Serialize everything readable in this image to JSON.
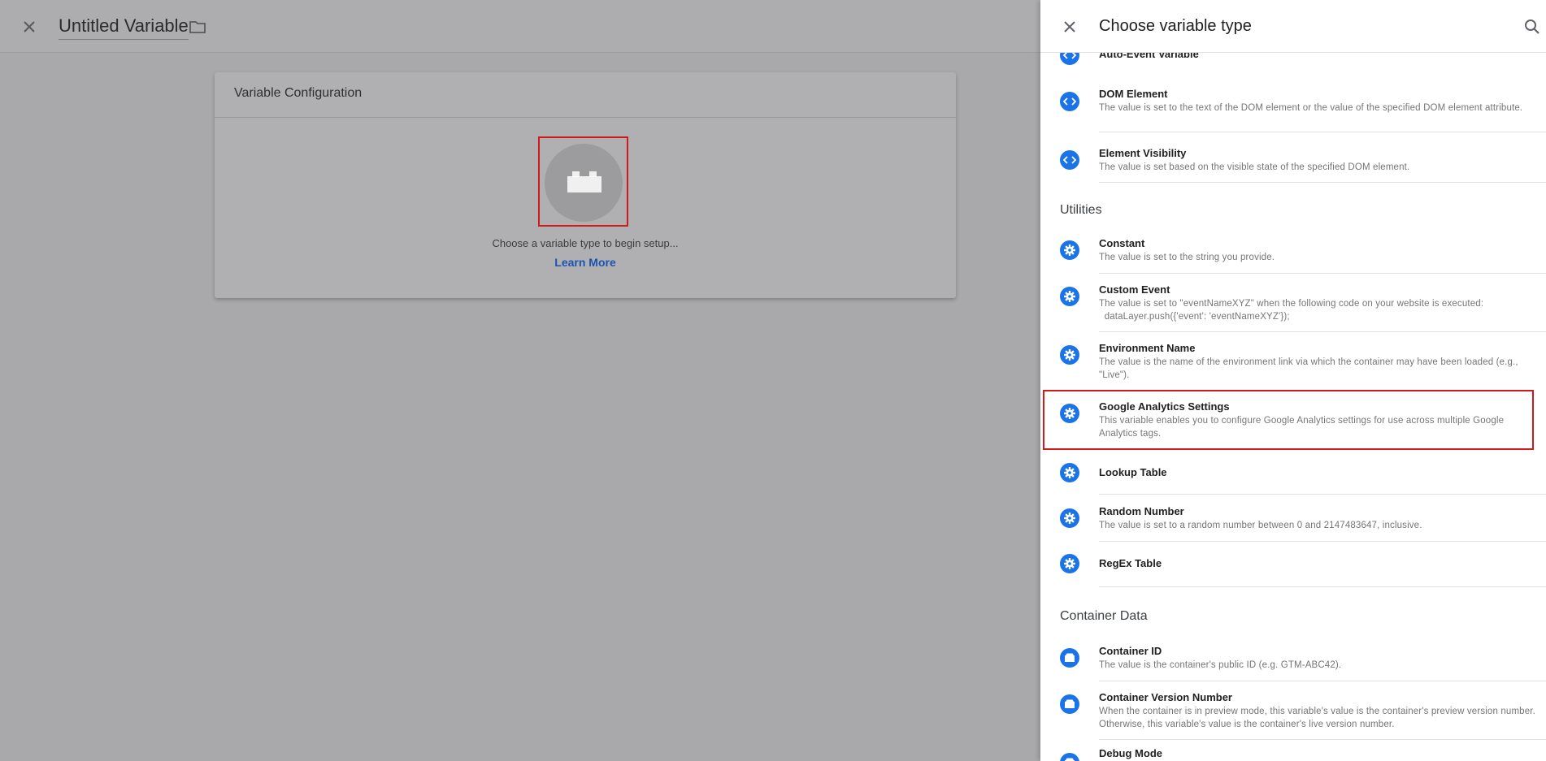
{
  "editor": {
    "title": "Untitled Variable",
    "card_title": "Variable Configuration",
    "choose_text": "Choose a variable type to begin setup...",
    "learn_more": "Learn More"
  },
  "panel": {
    "title": "Choose variable type",
    "top_item": "Auto-Event Variable",
    "page_elements": [
      {
        "name": "DOM Element",
        "desc": "The value is set to the text of the DOM element or the value of the specified DOM element attribute."
      },
      {
        "name": "Element Visibility",
        "desc": "The value is set based on the visible state of the specified DOM element."
      }
    ],
    "utilities_label": "Utilities",
    "utilities": [
      {
        "name": "Constant",
        "desc": "The value is set to the string you provide."
      },
      {
        "name": "Custom Event",
        "desc": "The value is set to \"eventNameXYZ\" when the following code on your website is executed:\n  dataLayer.push({'event': 'eventNameXYZ'});"
      },
      {
        "name": "Environment Name",
        "desc": "The value is the name of the environment link via which the container may have been loaded (e.g., \"Live\")."
      },
      {
        "name": "Google Analytics Settings",
        "desc": "This variable enables you to configure Google Analytics settings for use across multiple Google Analytics tags."
      },
      {
        "name": "Lookup Table",
        "desc": ""
      },
      {
        "name": "Random Number",
        "desc": "The value is set to a random number between 0 and 2147483647, inclusive."
      },
      {
        "name": "RegEx Table",
        "desc": ""
      }
    ],
    "container_label": "Container Data",
    "container": [
      {
        "name": "Container ID",
        "desc": "The value is the container's public ID (e.g. GTM-ABC42)."
      },
      {
        "name": "Container Version Number",
        "desc": "When the container is in preview mode, this variable's value is the container's preview version number. Otherwise, this variable's value is the container's live version number."
      },
      {
        "name": "Debug Mode",
        "desc": ""
      }
    ]
  },
  "colors": {
    "accent": "#1a73e8",
    "highlight": "#d11a1a",
    "overlay": "#a9a9ab"
  },
  "icons": [
    "close-icon",
    "folder-icon",
    "search-icon",
    "brick-icon",
    "code-icon",
    "gear-icon",
    "container-icon"
  ]
}
